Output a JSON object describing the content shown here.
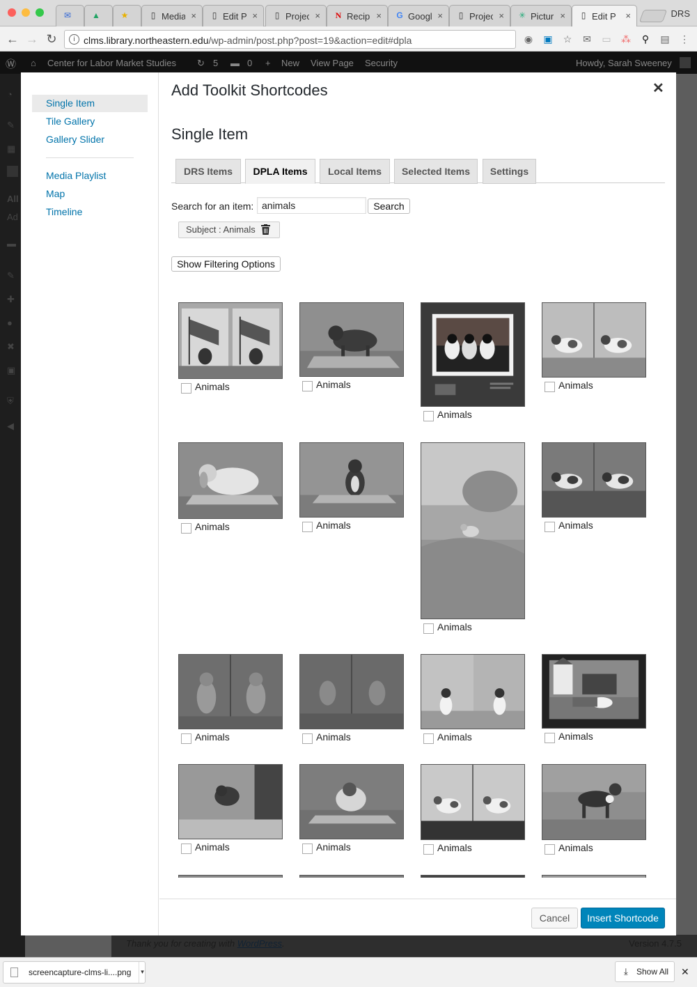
{
  "browser": {
    "tabs": [
      {
        "label": "",
        "icon": "mail-icon"
      },
      {
        "label": "",
        "icon": "drive-icon"
      },
      {
        "label": "",
        "icon": "star-icon"
      },
      {
        "label": "Media",
        "icon": "page-icon"
      },
      {
        "label": "Edit Pa",
        "icon": "page-icon"
      },
      {
        "label": "Projec",
        "icon": "page-icon"
      },
      {
        "label": "Recipi",
        "icon": "n-logo-icon"
      },
      {
        "label": "Googl",
        "icon": "google-icon"
      },
      {
        "label": "Projec",
        "icon": "page-icon"
      },
      {
        "label": "Pictur",
        "icon": "sparkle-icon"
      },
      {
        "label": "Edit Pa",
        "icon": "page-icon",
        "active": true
      }
    ],
    "profile_name": "DRS",
    "url_host": "clms.library.northeastern.edu",
    "url_path": "/wp-admin/post.php?post=19&action=edit#dpla"
  },
  "wp": {
    "site_name": "Center for Labor Market Studies",
    "updates_count": "5",
    "comments_count": "0",
    "new_label": "New",
    "view_page_label": "View Page",
    "security_label": "Security",
    "howdy": "Howdy, Sarah Sweeney",
    "footer_text": "Thank you for creating with",
    "footer_link": "WordPress",
    "version": "Version 4.7.5",
    "side_labels": {
      "all": "All",
      "add": "Ad"
    }
  },
  "modal": {
    "title": "Add Toolkit Shortcodes",
    "section_title": "Single Item",
    "menu": [
      "Single Item",
      "Tile Gallery",
      "Gallery Slider",
      "Media Playlist",
      "Map",
      "Timeline"
    ],
    "tabs": [
      "DRS Items",
      "DPLA Items",
      "Local Items",
      "Selected Items",
      "Settings"
    ],
    "search_label": "Search for an item:",
    "search_value": "animals",
    "search_button": "Search",
    "facet_chip": "Subject : Animals",
    "filter_button": "Show Filtering Options",
    "result_label": "Animals",
    "cancel_label": "Cancel",
    "insert_label": "Insert Shortcode"
  },
  "shelf": {
    "file_name": "screencapture-clms-li....png",
    "show_all": "Show All"
  },
  "colors": {
    "link": "#0073aa",
    "primary_button": "#0085ba",
    "admin_bar": "#111111"
  }
}
